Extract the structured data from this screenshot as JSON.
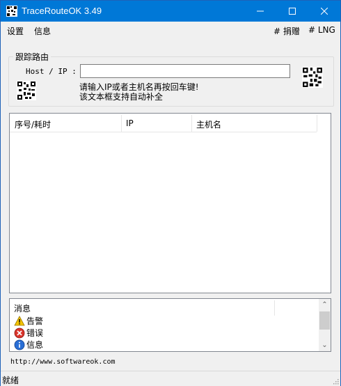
{
  "window": {
    "title": "TraceRouteOK 3.49"
  },
  "menu": {
    "settings": "设置",
    "info": "信息",
    "donate": "# 捐赠",
    "lng": "# LNG"
  },
  "trace_group": {
    "title": "跟踪路由",
    "host_label": "Host / IP :",
    "host_value": "",
    "hint_line1": "请输入IP或者主机名再按回车键!",
    "hint_line2": "该文本框支持自动补全"
  },
  "results_table": {
    "columns": [
      "序号/耗时",
      "IP",
      "主机名"
    ],
    "rows": []
  },
  "messages": {
    "header": "消息",
    "items": [
      {
        "icon": "warning-icon",
        "label": "告警"
      },
      {
        "icon": "error-icon",
        "label": "错误"
      },
      {
        "icon": "info-icon",
        "label": "信息"
      }
    ]
  },
  "footer": {
    "url": "http://www.softwareok.com",
    "status": "就绪"
  },
  "colors": {
    "titlebar": "#0078d7",
    "window_bg": "#f0f0f0",
    "warning": "#f5c400",
    "error": "#d9342b",
    "info": "#2a6fd6"
  }
}
